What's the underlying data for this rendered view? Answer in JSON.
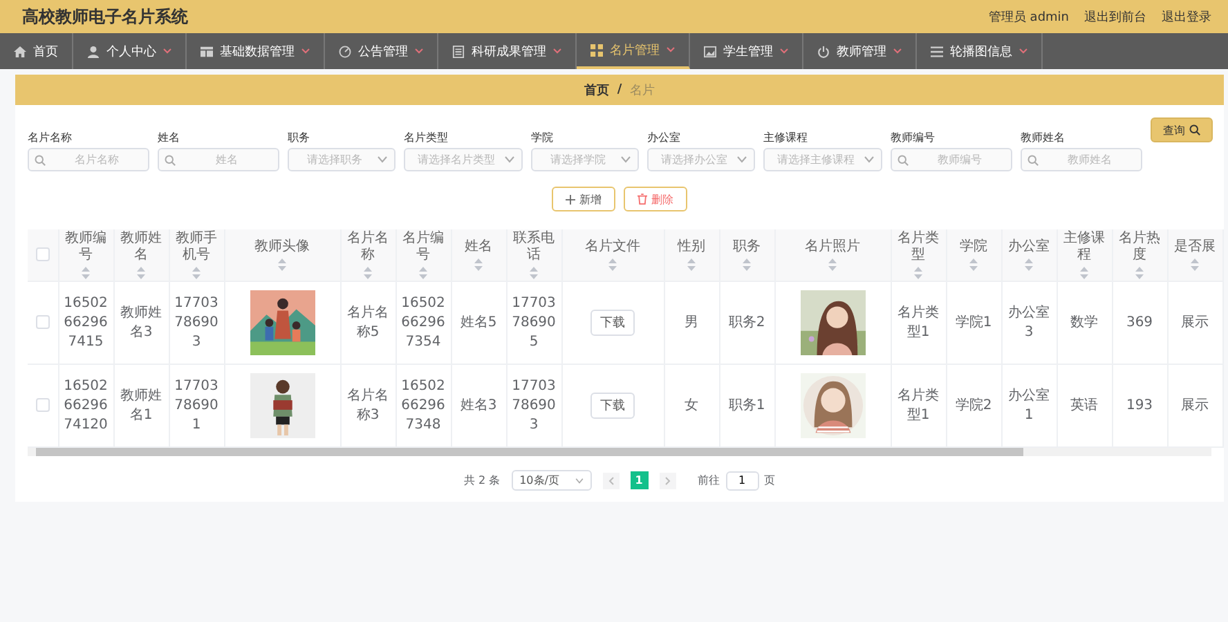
{
  "header": {
    "title": "高校教师电子名片系统",
    "user": "管理员 admin",
    "links": [
      "退出到前台",
      "退出登录"
    ]
  },
  "nav": [
    {
      "label": "首页",
      "dropdown": false,
      "selected": false
    },
    {
      "label": "个人中心",
      "dropdown": true,
      "selected": false
    },
    {
      "label": "基础数据管理",
      "dropdown": true,
      "selected": false
    },
    {
      "label": "公告管理",
      "dropdown": true,
      "selected": false
    },
    {
      "label": "科研成果管理",
      "dropdown": true,
      "selected": false
    },
    {
      "label": "名片管理",
      "dropdown": true,
      "selected": true
    },
    {
      "label": "学生管理",
      "dropdown": true,
      "selected": false
    },
    {
      "label": "教师管理",
      "dropdown": true,
      "selected": false
    },
    {
      "label": "轮播图信息",
      "dropdown": true,
      "selected": false
    }
  ],
  "breadcrumb": {
    "items": [
      {
        "label": "首页",
        "current": false
      },
      {
        "label": "名片",
        "current": true
      }
    ],
    "separator": "/"
  },
  "filters": [
    {
      "label": "名片名称",
      "kind": "text",
      "placeholder": "名片名称"
    },
    {
      "label": "姓名",
      "kind": "text",
      "placeholder": "姓名"
    },
    {
      "label": "职务",
      "kind": "select",
      "placeholder": "请选择职务"
    },
    {
      "label": "名片类型",
      "kind": "select",
      "placeholder": "请选择名片类型"
    },
    {
      "label": "学院",
      "kind": "select",
      "placeholder": "请选择学院"
    },
    {
      "label": "办公室",
      "kind": "select",
      "placeholder": "请选择办公室"
    },
    {
      "label": "主修课程",
      "kind": "select",
      "placeholder": "请选择主修课程"
    },
    {
      "label": "教师编号",
      "kind": "text",
      "placeholder": "教师编号"
    },
    {
      "label": "教师姓名",
      "kind": "text",
      "placeholder": "教师姓名"
    }
  ],
  "query_button": "查询",
  "actions": [
    {
      "label": "新增",
      "kind": "add"
    },
    {
      "label": "删除",
      "kind": "delete"
    }
  ],
  "table": {
    "header_checked": false,
    "columns": [
      {
        "label": "教师编号",
        "kind": "text",
        "sortable": true
      },
      {
        "label": "教师姓名",
        "kind": "text",
        "sortable": true
      },
      {
        "label": "教师手机号",
        "kind": "text",
        "sortable": true
      },
      {
        "label": "教师头像",
        "kind": "picture",
        "sortable": true
      },
      {
        "label": "名片名称",
        "kind": "text",
        "sortable": true
      },
      {
        "label": "名片编号",
        "kind": "text",
        "sortable": true
      },
      {
        "label": "姓名",
        "kind": "text",
        "sortable": true
      },
      {
        "label": "联系电话",
        "kind": "text",
        "sortable": true
      },
      {
        "label": "名片文件",
        "kind": "button",
        "sortable": true
      },
      {
        "label": "性别",
        "kind": "text",
        "sortable": true
      },
      {
        "label": "职务",
        "kind": "text",
        "sortable": true
      },
      {
        "label": "名片照片",
        "kind": "picture",
        "sortable": true
      },
      {
        "label": "名片类型",
        "kind": "text",
        "sortable": true
      },
      {
        "label": "学院",
        "kind": "text",
        "sortable": true
      },
      {
        "label": "办公室",
        "kind": "text",
        "sortable": true
      },
      {
        "label": "主修课程",
        "kind": "text",
        "sortable": true
      },
      {
        "label": "名片热度",
        "kind": "text",
        "sortable": true
      },
      {
        "label": "是否展",
        "kind": "text",
        "sortable": true
      }
    ],
    "rows": [
      {
        "checked": false,
        "cells": [
          {
            "text": "16502662967415"
          },
          {
            "text": "教师姓名3"
          },
          {
            "text": "17703786903"
          },
          {
            "kind": "picture"
          },
          {
            "text": "名片名称5"
          },
          {
            "text": "16502662967354"
          },
          {
            "text": "姓名5"
          },
          {
            "text": "17703786905"
          },
          {
            "text": "下载"
          },
          {
            "text": "男"
          },
          {
            "text": "职务2"
          },
          {
            "kind": "picture"
          },
          {
            "text": "名片类型1"
          },
          {
            "text": "学院1"
          },
          {
            "text": "办公室3"
          },
          {
            "text": "数学"
          },
          {
            "text": "369"
          },
          {
            "text": "展示"
          }
        ]
      },
      {
        "checked": false,
        "cells": [
          {
            "text": "165026629674120"
          },
          {
            "text": "教师姓名1"
          },
          {
            "text": "17703786901"
          },
          {
            "kind": "picture"
          },
          {
            "text": "名片名称3"
          },
          {
            "text": "16502662967348"
          },
          {
            "text": "姓名3"
          },
          {
            "text": "17703786903"
          },
          {
            "text": "下载"
          },
          {
            "text": "女"
          },
          {
            "text": "职务1"
          },
          {
            "kind": "picture"
          },
          {
            "text": "名片类型1"
          },
          {
            "text": "学院2"
          },
          {
            "text": "办公室1"
          },
          {
            "text": "英语"
          },
          {
            "text": "193"
          },
          {
            "text": "展示"
          }
        ]
      }
    ]
  },
  "pagination": {
    "total": "共 2 条",
    "page_size": "10条/页",
    "pages": [
      {
        "label": "1",
        "selected": true
      }
    ],
    "goto_label": "前往",
    "goto_value": "1",
    "goto_suffix": "页"
  }
}
